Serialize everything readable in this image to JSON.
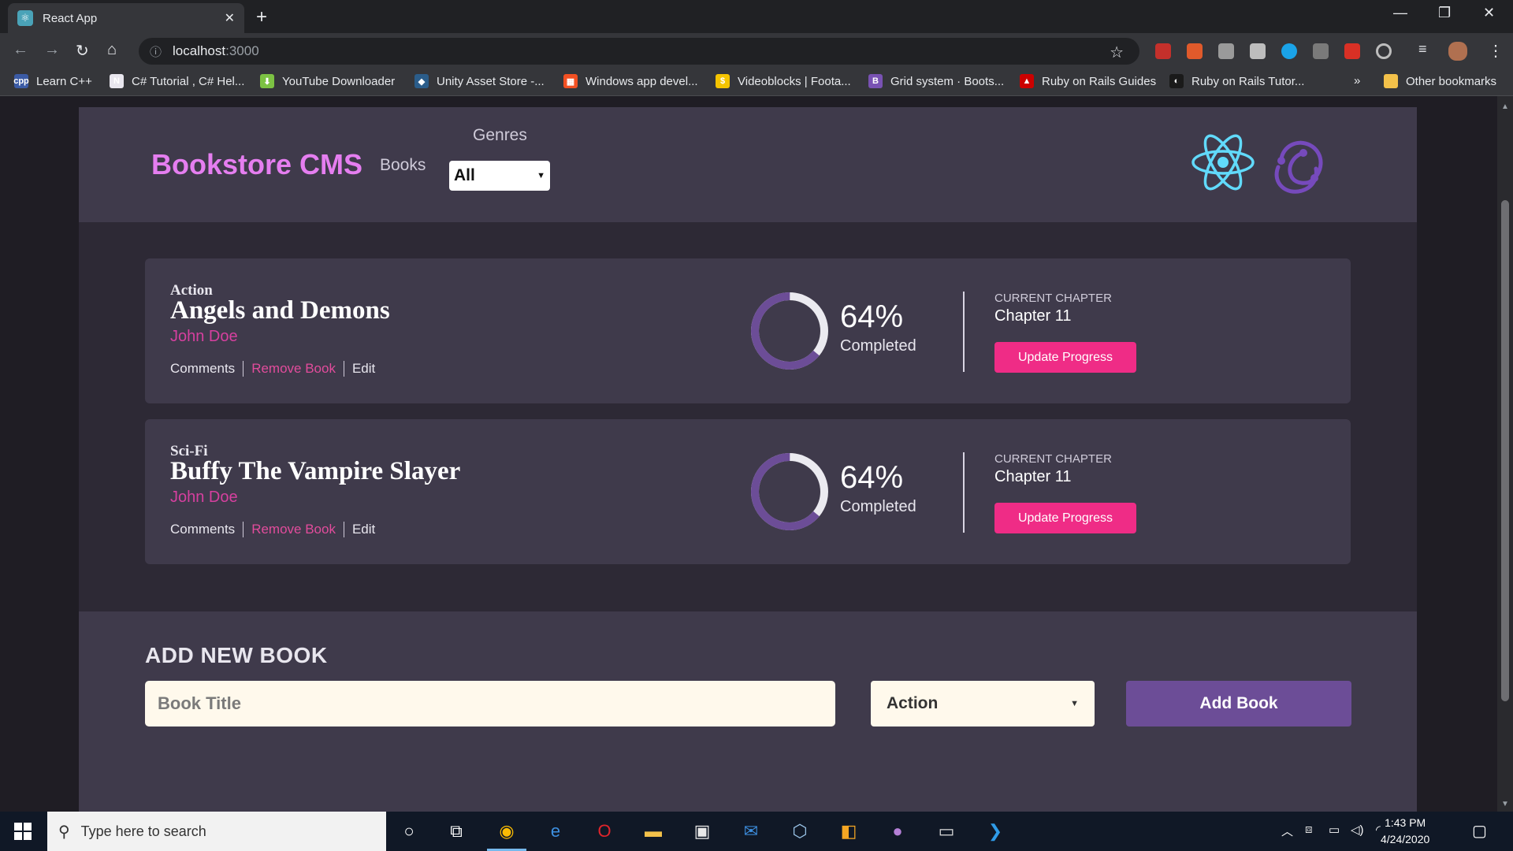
{
  "browser": {
    "tab_title": "React App",
    "tab_close": "✕",
    "new_tab": "+",
    "url_host": "localhost",
    "url_port": ":3000",
    "bookmarks": [
      {
        "label": "Learn C++",
        "color": "#3b5ba5",
        "glyph": "cpp"
      },
      {
        "label": "C# Tutorial , C# Hel...",
        "color": "#e8e6ee",
        "glyph": "N"
      },
      {
        "label": "YouTube Downloader",
        "color": "#7cc243",
        "glyph": "⬇"
      },
      {
        "label": "Unity Asset Store -...",
        "color": "#2b5d8a",
        "glyph": "◆"
      },
      {
        "label": "Windows app devel...",
        "color": "#f25022",
        "glyph": "▦"
      },
      {
        "label": "Videoblocks | Foota...",
        "color": "#f5c400",
        "glyph": "$"
      },
      {
        "label": "Grid system · Boots...",
        "color": "#7952b3",
        "glyph": "B"
      },
      {
        "label": "Ruby on Rails Guides",
        "color": "#cc0000",
        "glyph": "▲"
      },
      {
        "label": "Ruby on Rails Tutor...",
        "color": "#1a1a1a",
        "glyph": "◐"
      }
    ],
    "bookmarks_overflow": "»",
    "other_bookmarks": "Other bookmarks"
  },
  "app": {
    "brand": "Bookstore CMS",
    "nav_books": "Books",
    "genres_label": "Genres",
    "genre_filter_value": "All"
  },
  "books": [
    {
      "genre": "Action",
      "title": "Angels and Demons",
      "author": "John Doe",
      "comments_label": "Comments",
      "remove_label": "Remove Book",
      "edit_label": "Edit",
      "progress_percent": 64,
      "progress_text": "64%",
      "completed_label": "Completed",
      "current_chapter_label": "CURRENT CHAPTER",
      "current_chapter": "Chapter 11",
      "update_label": "Update Progress"
    },
    {
      "genre": "Sci-Fi",
      "title": "Buffy The Vampire Slayer",
      "author": "John Doe",
      "comments_label": "Comments",
      "remove_label": "Remove Book",
      "edit_label": "Edit",
      "progress_percent": 64,
      "progress_text": "64%",
      "completed_label": "Completed",
      "current_chapter_label": "CURRENT CHAPTER",
      "current_chapter": "Chapter 11",
      "update_label": "Update Progress"
    }
  ],
  "add_form": {
    "heading": "ADD NEW BOOK",
    "title_placeholder": "Book Title",
    "category_value": "Action",
    "submit_label": "Add Book"
  },
  "taskbar": {
    "search_placeholder": "Type here to search",
    "time": "1:43 PM",
    "date": "4/24/2020"
  },
  "colors": {
    "accent_pink": "#ef2c86",
    "brand_pink": "#e57ef0",
    "progress_purple": "#6c4d97",
    "card_bg": "#3f3a4b"
  }
}
